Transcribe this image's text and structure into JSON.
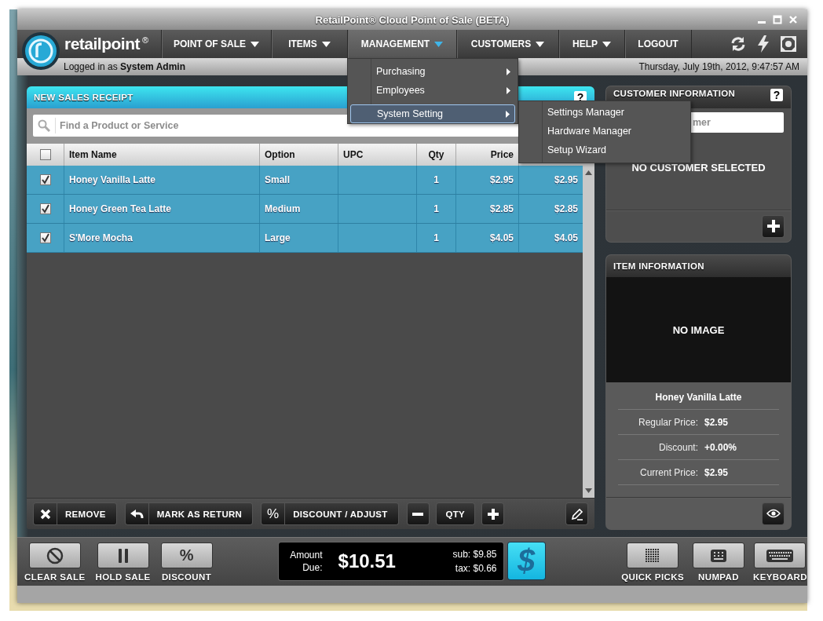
{
  "window": {
    "title": "RetailPoint® Cloud Point of Sale (BETA)"
  },
  "brand": {
    "name": "retailpoint",
    "mark": "®"
  },
  "nav": [
    {
      "label": "POINT OF SALE",
      "has_menu": true,
      "selected": false
    },
    {
      "label": "ITEMS",
      "has_menu": true,
      "selected": false
    },
    {
      "label": "MANAGEMENT",
      "has_menu": true,
      "selected": true
    },
    {
      "label": "CUSTOMERS",
      "has_menu": true,
      "selected": false
    },
    {
      "label": "HELP",
      "has_menu": true,
      "selected": false
    },
    {
      "label": "LOGOUT",
      "has_menu": false,
      "selected": false
    }
  ],
  "status": {
    "prefix": "Logged in as",
    "user": "System Admin",
    "datetime": "Thursday, July 19th, 2012, 9:47:57 AM"
  },
  "menu": {
    "items": [
      {
        "label": "Purchasing",
        "selected": false
      },
      {
        "label": "Employees",
        "selected": false
      },
      {
        "label": "System Setting",
        "selected": true
      }
    ]
  },
  "submenu": {
    "items": [
      "Settings Manager",
      "Hardware Manager",
      "Setup Wizard"
    ]
  },
  "receipt": {
    "title": "NEW SALES RECEIPT",
    "help": "?",
    "search": {
      "placeholder": "Find a Product or Service"
    },
    "select_all": {
      "checked": false
    },
    "columns": [
      "Item Name",
      "Option",
      "UPC",
      "Qty",
      "Price"
    ],
    "rows": [
      {
        "checked": true,
        "item_name": "Honey Vanilla Latte",
        "option": "Small",
        "qty": "1",
        "price": "$2.95",
        "column_6": "$2.95"
      },
      {
        "checked": true,
        "item_name": "Honey Green Tea Latte",
        "option": "Medium",
        "qty": "1",
        "price": "$2.85",
        "column_6": "$2.85"
      },
      {
        "checked": true,
        "item_name": "S'More Mocha",
        "option": "Large",
        "qty": "1",
        "price": "$4.05",
        "column_6": "$4.05"
      }
    ],
    "actions": {
      "remove": "REMOVE",
      "mark_return": "MARK AS RETURN",
      "discount_icon": "%",
      "discount": "DISCOUNT / ADJUST",
      "qty": "QTY"
    }
  },
  "customer": {
    "title": "CUSTOMER INFORMATION",
    "help": "?",
    "search": {
      "placeholder": "mer"
    },
    "status": "NO CUSTOMER SELECTED"
  },
  "item_info": {
    "title": "ITEM INFORMATION",
    "image_text": "NO IMAGE",
    "name": "Honey Vanilla Latte",
    "fields": [
      {
        "label": "Regular Price:",
        "value": "$2.95"
      },
      {
        "label": "Discount:",
        "value": "+0.00%"
      },
      {
        "label": "Current Price:",
        "value": "$2.95"
      }
    ]
  },
  "bottom": {
    "clear_sale": "CLEAR SALE",
    "hold_sale": "HOLD SALE",
    "discount_icon": "%",
    "discount": "DISCOUNT",
    "amount_label": "Amount Due:",
    "amount": "$10.51",
    "sub": "sub: $9.85",
    "tax": "tax: $0.66",
    "pay": "$",
    "quick_picks": "QUICK PICKS",
    "numpad": "NUMPAD",
    "keyboard": "KEYBOARD"
  }
}
